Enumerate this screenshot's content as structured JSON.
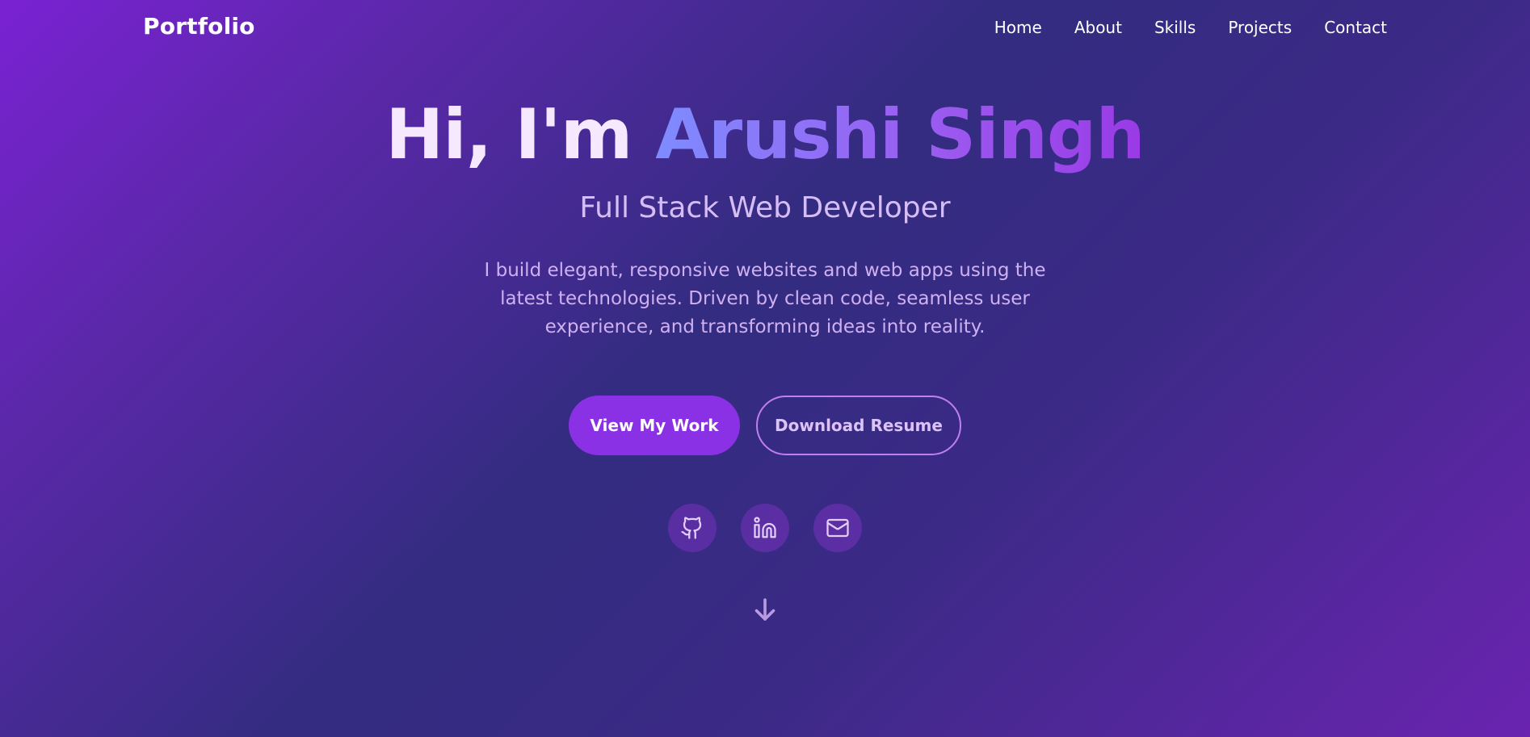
{
  "navbar": {
    "logo": "Portfolio",
    "links": [
      {
        "label": "Home"
      },
      {
        "label": "About"
      },
      {
        "label": "Skills"
      },
      {
        "label": "Projects"
      },
      {
        "label": "Contact"
      }
    ]
  },
  "hero": {
    "greeting": "Hi, I'm ",
    "name": "Arushi Singh",
    "subtitle": "Full Stack Web Developer",
    "description": "I build elegant, responsive websites and web apps using the latest technologies. Driven by clean code, seamless user experience, and transforming ideas into reality."
  },
  "buttons": {
    "primary_label": "View My Work",
    "secondary_label": "Download Resume"
  },
  "socials": [
    {
      "icon": "github-icon"
    },
    {
      "icon": "linkedin-icon"
    },
    {
      "icon": "mail-icon"
    }
  ],
  "scroll": {
    "icon": "arrow-down-icon"
  },
  "colors": {
    "accent": "#8a31e6",
    "name_gradient_start": "#7e8cff",
    "name_gradient_end": "#9a3ae6",
    "background_dark": "#332c80",
    "background_light": "#7a22d3"
  }
}
